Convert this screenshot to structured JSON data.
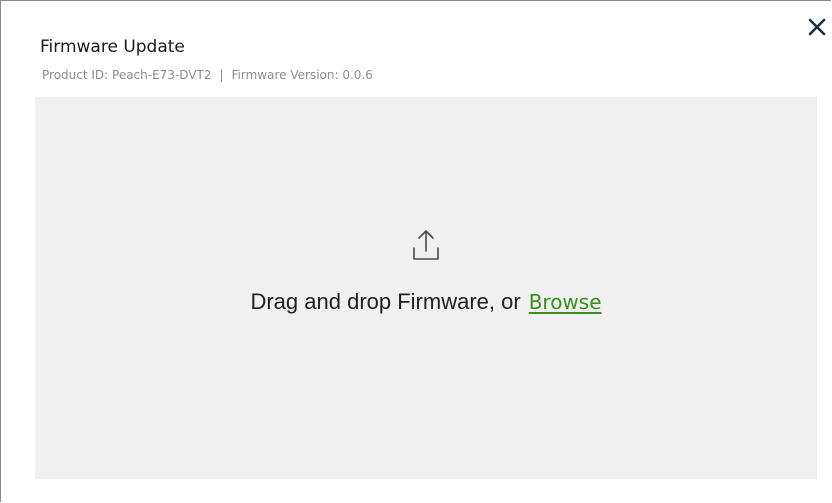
{
  "dialog": {
    "title": "Firmware Update",
    "product_id": "Product ID: Peach-E73-DVT2",
    "separator": "|",
    "firmware_version": "Firmware Version: 0.0.6"
  },
  "dropzone": {
    "icon": "upload-icon",
    "prompt": "Drag and drop Firmware, or",
    "browse_label": "Browse"
  },
  "colors": {
    "dropzone_bg": "#f0f0f0",
    "browse_link": "#3a8d1e",
    "subtitle_text": "#8c8c8c"
  }
}
